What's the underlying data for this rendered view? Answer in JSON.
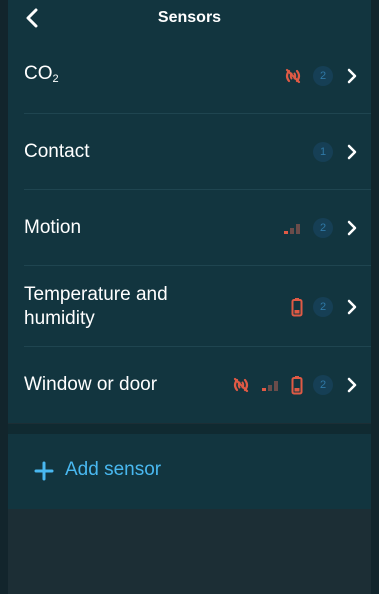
{
  "header": {
    "title": "Sensors",
    "back_icon": "chevron-left-icon"
  },
  "sensors": [
    {
      "label": "CO",
      "subscript": "2",
      "count": "2",
      "icons": [
        "signal-off-icon"
      ]
    },
    {
      "label": "Contact",
      "count": "1",
      "icons": []
    },
    {
      "label": "Motion",
      "count": "2",
      "icons": [
        "signal-weak-icon"
      ]
    },
    {
      "label": "Temperature and humidity",
      "count": "2",
      "icons": [
        "battery-low-icon"
      ]
    },
    {
      "label": "Window or door",
      "count": "2",
      "icons": [
        "signal-off-icon",
        "signal-weak-icon",
        "battery-low-icon"
      ]
    }
  ],
  "add_sensor": {
    "label": "Add sensor",
    "icon": "plus-icon"
  },
  "colors": {
    "panel": "#12353f",
    "background": "#1c2e35",
    "accent": "#49b8f0",
    "warning": "#e05a45",
    "badge_bg": "#163f55",
    "badge_text": "#2f78a6"
  }
}
